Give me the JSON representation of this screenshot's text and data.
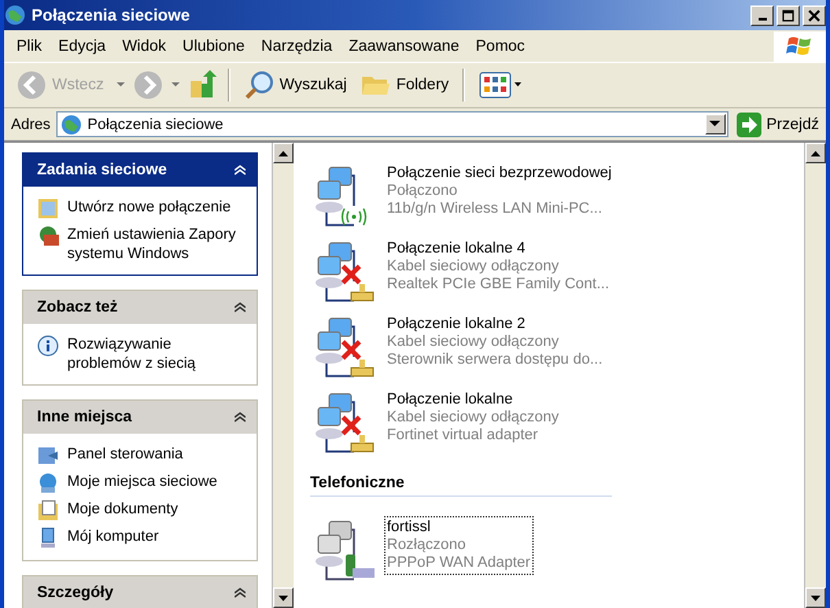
{
  "window": {
    "title": "Połączenia sieciowe"
  },
  "menu": [
    {
      "label": "Plik"
    },
    {
      "label": "Edycja"
    },
    {
      "label": "Widok"
    },
    {
      "label": "Ulubione"
    },
    {
      "label": "Narzędzia"
    },
    {
      "label": "Zaawansowane"
    },
    {
      "label": "Pomoc"
    }
  ],
  "toolbar": {
    "back": {
      "label": "Wstecz",
      "disabled": true
    },
    "search": {
      "label": "Wyszukaj"
    },
    "folders": {
      "label": "Foldery"
    }
  },
  "address": {
    "label": "Adres",
    "value": "Połączenia sieciowe",
    "go": "Przejdź"
  },
  "task_panes": [
    {
      "title": "Zadania sieciowe",
      "kind": "primary",
      "items": [
        {
          "label": "Utwórz nowe połączenie"
        },
        {
          "label": "Zmień ustawienia Zapory systemu Windows"
        }
      ]
    },
    {
      "title": "Zobacz też",
      "kind": "secondary",
      "items": [
        {
          "label": "Rozwiązywanie problemów z siecią"
        }
      ]
    },
    {
      "title": "Inne miejsca",
      "kind": "secondary",
      "items": [
        {
          "label": "Panel sterowania"
        },
        {
          "label": "Moje miejsca sieciowe"
        },
        {
          "label": "Moje dokumenty"
        },
        {
          "label": "Mój komputer"
        }
      ]
    },
    {
      "title": "Szczegóły",
      "kind": "secondary"
    }
  ],
  "groups": [
    {
      "connections": [
        {
          "name": "Połączenie sieci bezprzewodowej",
          "status": "Połączono",
          "device": "11b/g/n  Wireless LAN Mini-PC...",
          "kind": "wireless",
          "selected": false
        },
        {
          "name": "Połączenie lokalne 4",
          "status": "Kabel sieciowy odłączony",
          "device": "Realtek PCIe GBE Family Cont...",
          "kind": "disconnected",
          "selected": false
        },
        {
          "name": "Połączenie lokalne 2",
          "status": "Kabel sieciowy odłączony",
          "device": "Sterownik serwera dostępu do...",
          "kind": "disconnected",
          "selected": false
        },
        {
          "name": "Połączenie lokalne",
          "status": "Kabel sieciowy odłączony",
          "device": "Fortinet virtual adapter",
          "kind": "disconnected",
          "selected": false
        }
      ]
    },
    {
      "heading": "Telefoniczne",
      "connections": [
        {
          "name": "fortissl",
          "status": "Rozłączono",
          "device": "PPPoP WAN Adapter",
          "kind": "dialup",
          "selected": true
        }
      ]
    }
  ]
}
